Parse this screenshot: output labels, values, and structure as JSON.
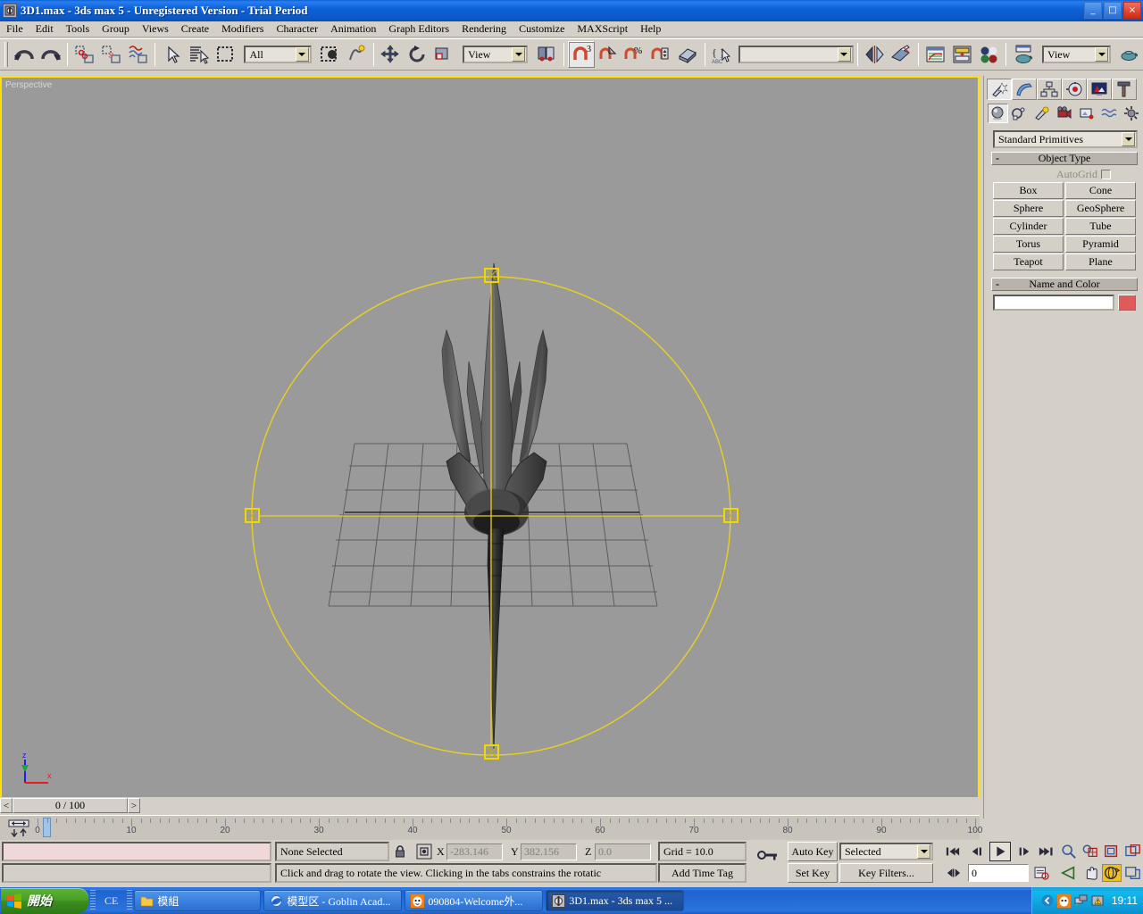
{
  "window": {
    "title": "3D1.max - 3ds max 5 - Unregistered Version - Trial Period",
    "minimize": "_",
    "maximize": "□",
    "close": "×"
  },
  "menubar": {
    "items": [
      {
        "label": "File"
      },
      {
        "label": "Edit"
      },
      {
        "label": "Tools"
      },
      {
        "label": "Group"
      },
      {
        "label": "Views"
      },
      {
        "label": "Create"
      },
      {
        "label": "Modifiers"
      },
      {
        "label": "Character"
      },
      {
        "label": "Animation"
      },
      {
        "label": "Graph Editors"
      },
      {
        "label": "Rendering"
      },
      {
        "label": "Customize"
      },
      {
        "label": "MAXScript"
      },
      {
        "label": "Help"
      }
    ]
  },
  "toolbar": {
    "selection_filter": "All",
    "reference_coord_system": "View",
    "named_selection_sets": "",
    "viewport_layout": "View",
    "buttons": [
      "undo-icon",
      "redo-icon",
      "select-and-link-icon",
      "unlink-selection-icon",
      "bind-to-space-warp-icon",
      "select-object-icon",
      "select-by-name-icon",
      "rectangular-select-region-icon",
      "window-crossing-icon",
      "select-and-move-icon",
      "select-and-rotate-icon",
      "select-and-scale-icon",
      "use-pivot-center-icon",
      "mirror-icon",
      "align-icon",
      "curve-editor-icon",
      "schematic-view-icon",
      "material-editor-icon",
      "render-scene-icon",
      "quick-render-icon"
    ],
    "snap_value": "3"
  },
  "viewport": {
    "label": "Perspective",
    "background_color": "#9a9a9a",
    "border_color": "#ffe000",
    "gizmo_color": "#ffd400",
    "axis": {
      "x": "x",
      "y": "y",
      "z": "z"
    },
    "object": "trident-spear-head-mesh"
  },
  "command_panel": {
    "tabs": [
      {
        "name": "create",
        "icon": "create-wand-icon",
        "selected": true
      },
      {
        "name": "modify",
        "icon": "modify-curve-icon",
        "selected": false
      },
      {
        "name": "hierarchy",
        "icon": "hierarchy-icon",
        "selected": false
      },
      {
        "name": "motion",
        "icon": "motion-wheel-icon",
        "selected": false
      },
      {
        "name": "display",
        "icon": "display-monitor-icon",
        "selected": false
      },
      {
        "name": "utilities",
        "icon": "utilities-hammer-icon",
        "selected": false
      }
    ],
    "subtabs": [
      {
        "name": "geometry",
        "icon": "geometry-sphere-icon",
        "selected": true
      },
      {
        "name": "shapes",
        "icon": "shapes-icon",
        "selected": false
      },
      {
        "name": "lights",
        "icon": "lights-icon",
        "selected": false
      },
      {
        "name": "cameras",
        "icon": "camera-icon",
        "selected": false
      },
      {
        "name": "helpers",
        "icon": "helpers-icon",
        "selected": false
      },
      {
        "name": "space-warps",
        "icon": "space-warps-icon",
        "selected": false
      },
      {
        "name": "systems",
        "icon": "systems-gear-icon",
        "selected": false
      }
    ],
    "category": "Standard Primitives",
    "object_type": {
      "title": "Object Type",
      "collapse": "-",
      "autogrid_label": "AutoGrid",
      "autogrid_checked": false,
      "buttons": [
        "Box",
        "Cone",
        "Sphere",
        "GeoSphere",
        "Cylinder",
        "Tube",
        "Torus",
        "Pyramid",
        "Teapot",
        "Plane"
      ]
    },
    "name_and_color": {
      "title": "Name and Color",
      "collapse": "-",
      "name_value": "",
      "color": "#e05a5a"
    }
  },
  "time_slider": {
    "value": "0 / 100",
    "prev": "<",
    "next": ">"
  },
  "track_bar": {
    "labels": [
      "0",
      "10",
      "20",
      "30",
      "40",
      "50",
      "60",
      "70",
      "80",
      "90",
      "100"
    ],
    "start": 0,
    "end": 100,
    "current_frame": 0
  },
  "status_bar": {
    "selection_status": "None Selected",
    "lock_icon": "lock-selection-icon",
    "coord_mode_icon": "absolute-relative-transform-icon",
    "x_label": "X",
    "x_value": "-283.146",
    "y_label": "Y",
    "y_value": "382.156",
    "z_label": "Z",
    "z_value": "0.0",
    "grid": "Grid = 10.0",
    "prompt": "Click and drag to rotate the view.  Clicking in the tabs constrains the rotatic",
    "add_time_tag": "Add Time Tag",
    "key_mode_icon": "key-mode-toggle-icon"
  },
  "animation_controls": {
    "auto_key": "Auto Key",
    "set_key": "Set Key",
    "key_filter_set": "Selected",
    "key_filters": "Key Filters...",
    "current_frame": "0",
    "transport": [
      "go-to-start-icon",
      "previous-frame-icon",
      "play-animation-icon",
      "next-frame-icon",
      "go-to-end-icon",
      "key-mode-icon",
      "time-configuration-icon"
    ]
  },
  "viewport_nav": {
    "buttons": [
      "zoom-icon",
      "zoom-all-icon",
      "zoom-extents-icon",
      "zoom-region-icon",
      "field-of-view-icon",
      "pan-icon",
      "arc-rotate-icon",
      "min-max-toggle-icon"
    ],
    "active": "arc-rotate-icon"
  },
  "taskbar": {
    "start": "開始",
    "quicklaunch_label": "CE",
    "items": [
      {
        "label": "模組",
        "icon": "folder-icon",
        "active": false
      },
      {
        "label": "模型区 - Goblin Acad...",
        "icon": "internet-explorer-icon",
        "active": false
      },
      {
        "label": "090804-Welcome外...",
        "icon": "qq-icon",
        "active": false
      },
      {
        "label": "3D1.max - 3ds max 5 ...",
        "icon": "3dsmax-icon",
        "active": true
      }
    ],
    "tray": [
      "show-hidden-icons-icon",
      "qq-tray-icon",
      "network-icon",
      "warning-icon"
    ],
    "clock": "19:11"
  }
}
